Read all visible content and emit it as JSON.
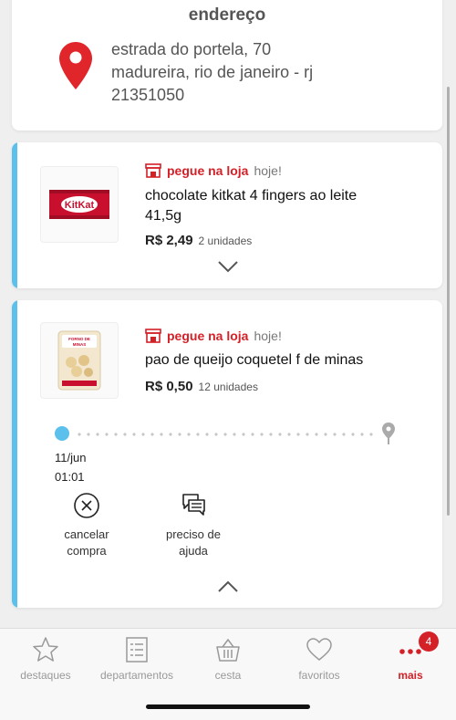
{
  "address": {
    "title": "endereço",
    "line1": "estrada do portela, 70",
    "line2": "madureira, rio de janeiro - rj",
    "line3": "21351050"
  },
  "orders": [
    {
      "pickup_label": "pegue na loja",
      "pickup_when": "hoje!",
      "name_line1": "chocolate kitkat 4 fingers ao leite",
      "name_line2": "41,5g",
      "price": "R$ 2,49",
      "quantity": "2 unidades",
      "thumb_text": "KitKat"
    },
    {
      "pickup_label": "pegue na loja",
      "pickup_when": "hoje!",
      "name_line1": "pao de queijo coquetel f de minas",
      "price": "R$ 0,50",
      "quantity": "12 unidades",
      "thumb_text": "FORNO DE MINAS",
      "timeline": {
        "date": "11/jun",
        "time": "01:01"
      },
      "actions": {
        "cancel_line1": "cancelar",
        "cancel_line2": "compra",
        "help_line1": "preciso de",
        "help_line2": "ajuda"
      }
    }
  ],
  "nav": {
    "items": [
      {
        "label": "destaques",
        "icon": "star-icon"
      },
      {
        "label": "departamentos",
        "icon": "list-icon"
      },
      {
        "label": "cesta",
        "icon": "basket-icon"
      },
      {
        "label": "favoritos",
        "icon": "heart-icon"
      },
      {
        "label": "mais",
        "icon": "more-dots-icon"
      }
    ],
    "badge_count": "4"
  },
  "colors": {
    "accent_red": "#d42128",
    "accent_blue": "#5bc0eb",
    "background": "#efefef"
  }
}
